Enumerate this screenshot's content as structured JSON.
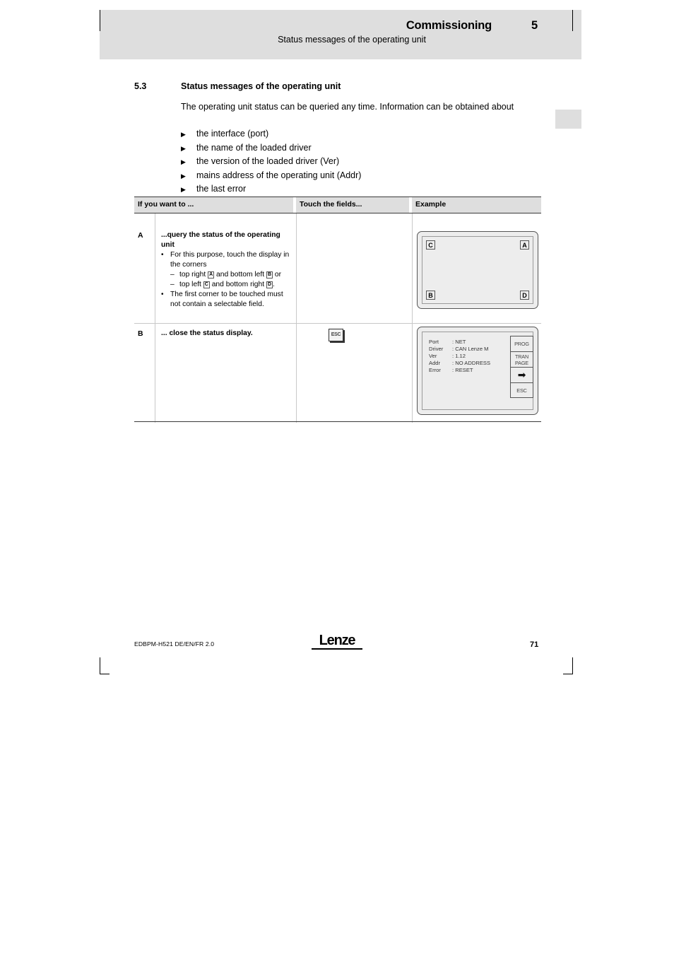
{
  "header": {
    "title": "Commissioning",
    "chapter_number": "5",
    "subtitle": "Status messages of the operating unit"
  },
  "section": {
    "number": "5.3",
    "title": "Status messages of the operating unit",
    "intro": "The operating unit status can be queried any time. Information can be obtained about",
    "bullet_marker": "▶",
    "bullets": [
      "the interface (port)",
      "the name of the loaded driver",
      "the version of the loaded driver (Ver)",
      "mains address of the operating unit (Addr)",
      "the last error"
    ]
  },
  "table": {
    "headers": {
      "col1": "If you want to ...",
      "col2": "Touch the fields...",
      "col3": "Example"
    },
    "rows": [
      {
        "letter": "A",
        "title": "...query the status of the operating unit",
        "items": [
          {
            "mark": "•",
            "text": "For this purpose, touch the display in the corners",
            "sub": [
              {
                "mark": "–",
                "pre": "top right ",
                "box1": "A",
                "mid": " and bottom left ",
                "box2": "B",
                "post": " or"
              },
              {
                "mark": "–",
                "pre": "top left ",
                "box1": "C",
                "mid": " and bottom right ",
                "box2": "D",
                "post": "."
              }
            ]
          },
          {
            "mark": "•",
            "text": "The first corner to be touched must not contain a selectable field.",
            "sub": []
          }
        ],
        "touch_field": "",
        "example": {
          "type": "corner-display",
          "corners": {
            "top_left": "C",
            "top_right": "A",
            "bottom_left": "B",
            "bottom_right": "D"
          }
        }
      },
      {
        "letter": "B",
        "title": "... close the status display.",
        "items": [],
        "touch_field": "ESC",
        "example": {
          "type": "status-screen",
          "status_lines": [
            {
              "key": "Port",
              "value": ": NET"
            },
            {
              "key": "Driver",
              "value": ": CAN Lenze M"
            },
            {
              "key": "Ver",
              "value": ": 1.12"
            },
            {
              "key": "Addr",
              "value": ": NO ADDRESS"
            },
            {
              "key": "Error",
              "value": ": RESET"
            }
          ],
          "buttons": [
            {
              "line1": "PROG",
              "line2": ""
            },
            {
              "line1": "TRAN",
              "line2": "PAGE"
            },
            {
              "line1": "➡",
              "line2": ""
            },
            {
              "line1": "ESC",
              "line2": ""
            }
          ]
        }
      }
    ]
  },
  "footer": {
    "document_code": "EDBPM-H521  DE/EN/FR  2.0",
    "logo": "Lenze",
    "page_number": "71"
  },
  "colors": {
    "header_band": "#dedede",
    "table_header_bg": "#dedede",
    "rule_dark": "#3a3a3a",
    "rule_light": "#c8c8c8",
    "device_fill": "#ededed"
  }
}
